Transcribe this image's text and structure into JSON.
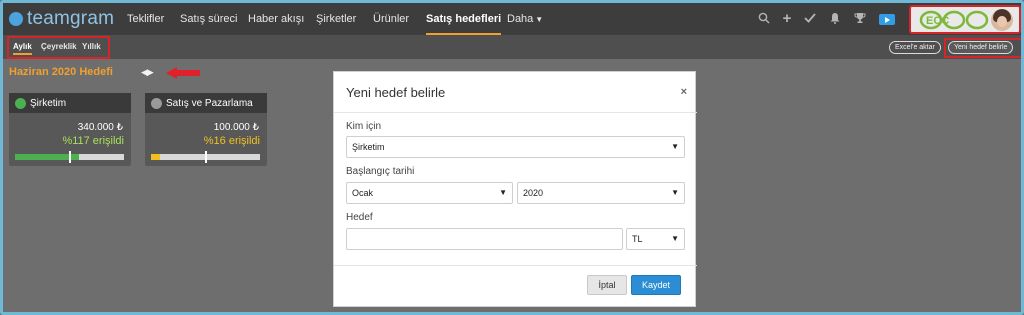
{
  "app": {
    "logo_text": "teamgram"
  },
  "nav": {
    "items": [
      "Teklifler",
      "Satış süreci",
      "Haber akışı",
      "Şirketler",
      "Ürünler",
      "Satış hedefleri"
    ],
    "more_label": "Daha",
    "active": "Satış hedefleri"
  },
  "brand": {
    "logo_text": "ECC"
  },
  "period_tabs": {
    "items": [
      "Aylık",
      "Çeyreklik",
      "Yıllık"
    ],
    "active": "Aylık"
  },
  "actions": {
    "export_label": "Excel'e aktar",
    "new_goal_label": "Yeni hedef belirle"
  },
  "page": {
    "heading": "Haziran 2020 Hedefi"
  },
  "cards": [
    {
      "title": "Şirketim",
      "amount": "340.000 ₺",
      "percent_text": "%117 erişildi",
      "percent": 117,
      "bar_color": "#4caf50",
      "text_color": "#a6e05a"
    },
    {
      "title": "Satış ve Pazarlama",
      "amount": "100.000 ₺",
      "percent_text": "%16 erişildi",
      "percent": 16,
      "bar_color": "#f0c020",
      "text_color": "#f0c020"
    }
  ],
  "modal": {
    "title": "Yeni hedef belirle",
    "close": "×",
    "for_label": "Kim için",
    "for_value": "Şirketim",
    "start_label": "Başlangıç tarihi",
    "month_value": "Ocak",
    "year_value": "2020",
    "goal_label": "Hedef",
    "goal_value": "",
    "currency_value": "TL",
    "cancel_label": "İptal",
    "save_label": "Kaydet"
  },
  "colors": {
    "accent": "#f0a030",
    "primary": "#2b8ed4",
    "highlight": "#d6252a"
  }
}
